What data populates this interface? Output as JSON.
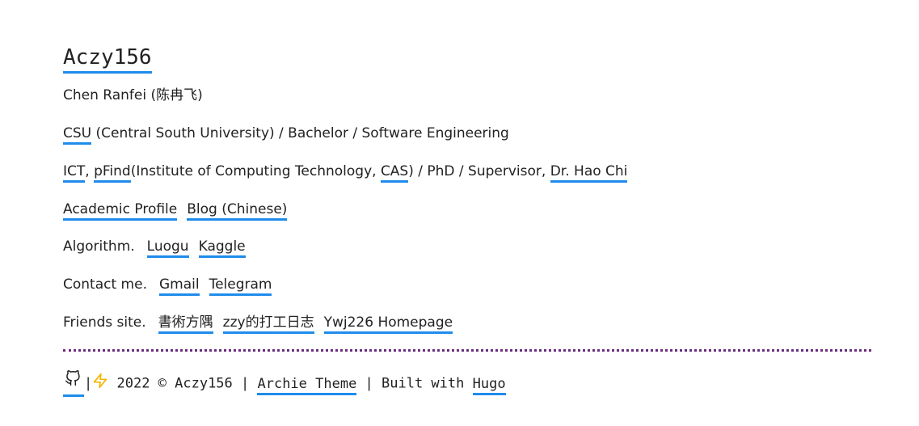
{
  "site": {
    "title": "Aczy156"
  },
  "profile": {
    "name_line": "Chen Ranfei (陈冉飞)",
    "education": {
      "link": "CSU",
      "text": " (Central South University) / Bachelor / Software Engineering"
    },
    "research": {
      "link1": "ICT",
      "comma": ", ",
      "link2": "pFind",
      "text1": "(Institute of Computing Technology, ",
      "link3": "CAS",
      "text2": ") / PhD / Supervisor, ",
      "link4": "Dr. Hao Chi"
    },
    "profiles": {
      "academic": "Academic Profile",
      "blog": "Blog (Chinese)"
    },
    "algorithm": {
      "label": "Algorithm.",
      "luogu": "Luogu",
      "kaggle": "Kaggle"
    },
    "contact": {
      "label": "Contact me.",
      "gmail": "Gmail",
      "telegram": "Telegram"
    },
    "friends": {
      "label": "Friends site.",
      "site1": "書術方隅",
      "site2": "zzy的打工日志",
      "site3": "Ywj226 Homepage"
    }
  },
  "footer": {
    "pipe1": "|",
    "copyright": " 2022 © Aczy156 | ",
    "theme": "Archie Theme",
    "built": " | Built with ",
    "hugo": "Hugo"
  },
  "colors": {
    "link_underline": "#1f8ceb",
    "separator": "#6b2d7d",
    "bolt": "#f5b400"
  },
  "icons": {
    "github": "github-icon",
    "bolt": "lightning-icon"
  }
}
